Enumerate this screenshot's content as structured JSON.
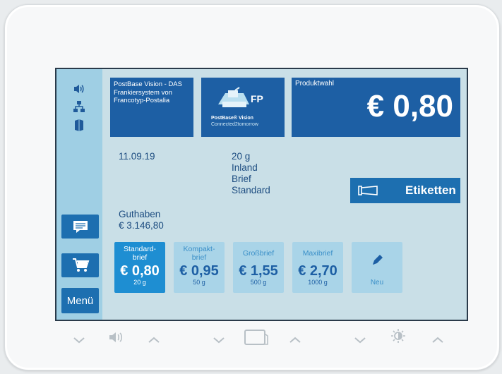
{
  "sidebar": {
    "icons": [
      "speaker-icon",
      "network-icon",
      "book-icon"
    ],
    "menu_label": "Menü"
  },
  "header": {
    "brand_tile": "PostBase Vision - DAS Frankiersystem von Francotyp-Postalia",
    "logo_tile": {
      "mark": "FP",
      "line1": "PostBase® Vision",
      "line2": "Connected2tomorrow"
    },
    "product_label": "Produktwahl",
    "price": "€ 0,80"
  },
  "info": {
    "date": "11.09.19",
    "weight": "20 g",
    "region": "Inland",
    "type": "Brief",
    "service": "Standard",
    "balance_label": "Guthaben",
    "balance_value": "€ 3.146,80"
  },
  "etiketten_label": "Etiketten",
  "products": [
    {
      "line1": "Standard-",
      "line2": "brief",
      "price": "€ 0,80",
      "weight": "20 g"
    },
    {
      "line1": "Kompakt-",
      "line2": "brief",
      "price": "€ 0,95",
      "weight": "50 g"
    },
    {
      "line1": "Großbrief",
      "line2": "",
      "price": "€ 1,55",
      "weight": "500 g"
    },
    {
      "line1": "Maxibrief",
      "line2": "",
      "price": "€ 2,70",
      "weight": "1000 g"
    }
  ],
  "new_label": "Neu",
  "colors": {
    "accent": "#1d6fb0",
    "screen_bg": "#c9dfe7",
    "sidebar_bg": "#9fcfe4",
    "tile_light": "#a9d4e8"
  }
}
